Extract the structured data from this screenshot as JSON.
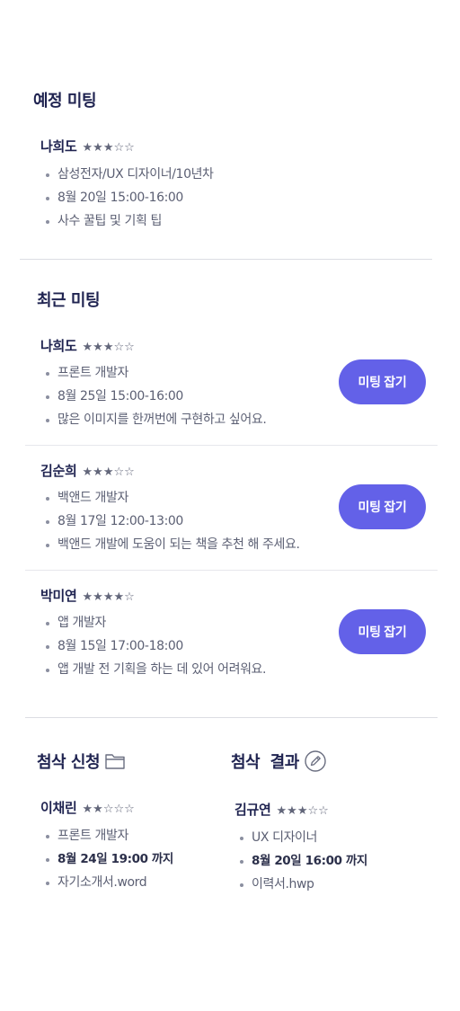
{
  "upcoming": {
    "title": "예정 미팅",
    "mentor": {
      "name": "나희도",
      "stars": "★★★☆☆",
      "details": [
        "삼성전자/UX 디자이너/10년차",
        "8월 20일 15:00-16:00",
        "사수 꿀팁 및 기획 팁"
      ]
    }
  },
  "recent": {
    "title": "최근 미팅",
    "button_label": "미팅 잡기",
    "items": [
      {
        "name": "나희도",
        "stars": "★★★☆☆",
        "details": [
          "프론트 개발자",
          "8월 25일 15:00-16:00",
          "많은 이미지를 한꺼번에 구현하고 싶어요."
        ]
      },
      {
        "name": "김순희",
        "stars": "★★★☆☆",
        "details": [
          "백앤드 개발자",
          "8월 17일 12:00-13:00",
          "백앤드 개발에 도움이 되는 책을 추천 해 주세요."
        ]
      },
      {
        "name": "박미연",
        "stars": "★★★★☆",
        "details": [
          "앱 개발자",
          "8월 15일 17:00-18:00",
          "앱 개발 전 기획을 하는 데 있어 어려워요."
        ]
      }
    ]
  },
  "review_request": {
    "title": "첨삭 신청",
    "icon": "folder-icon",
    "name": "이채린",
    "stars": "★★☆☆☆",
    "details": [
      "프론트 개발자",
      "8월 24일 19:00 까지",
      "자기소개서.word"
    ]
  },
  "review_result": {
    "title": "첨삭  결과",
    "icon": "edit-icon",
    "name": "김규연",
    "stars": "★★★☆☆",
    "details": [
      "UX 디자이너",
      "8월 20일 16:00 까지",
      "이력서.hwp"
    ]
  }
}
